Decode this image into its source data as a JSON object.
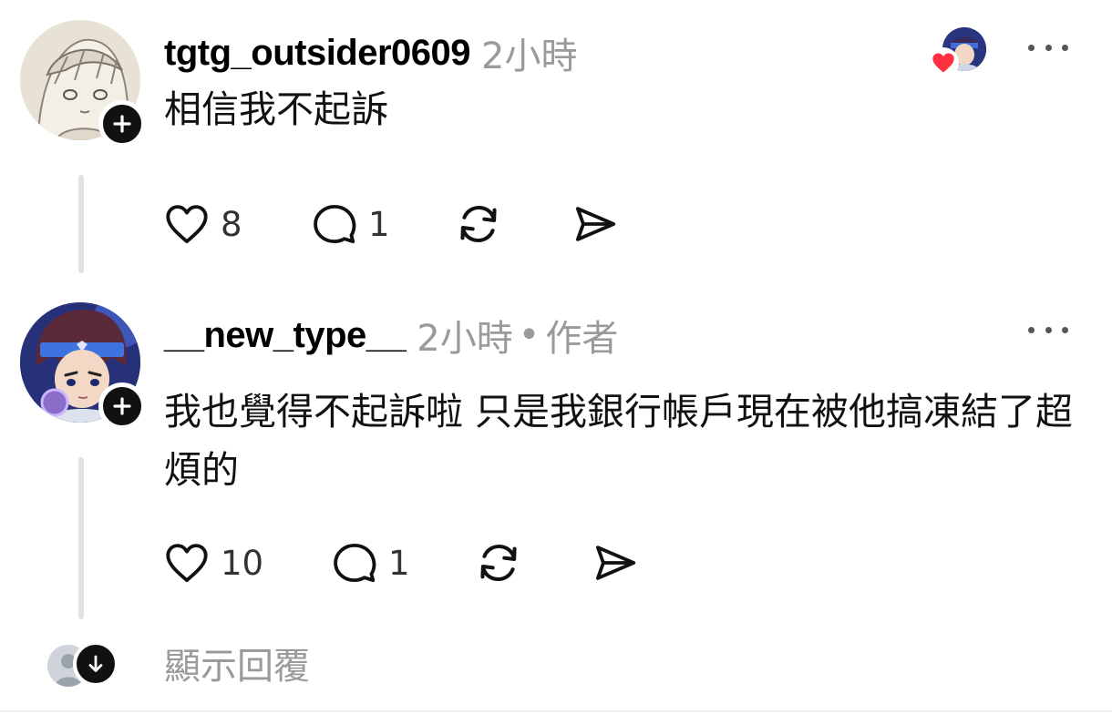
{
  "posts": [
    {
      "username": "tgtg_outsider0609",
      "time": "2小時",
      "text": "相信我不起訴",
      "likes": "8",
      "replies": "1",
      "avatar_icon": "sketch-anime-girl-avatar"
    },
    {
      "username": "__new_type__",
      "time": "2小時",
      "separator": "•",
      "role": "作者",
      "text": "我也覺得不起訴啦 只是我銀行帳戶現在被他搞凍結了超煩的",
      "likes": "10",
      "replies": "1",
      "avatar_icon": "anime-boy-headband-avatar"
    }
  ],
  "show_replies_label": "顯示回覆",
  "colors": {
    "text": "#000000",
    "muted": "#9a9a9a",
    "heart": "#ff3040",
    "thread_line": "#e2e2e2"
  }
}
